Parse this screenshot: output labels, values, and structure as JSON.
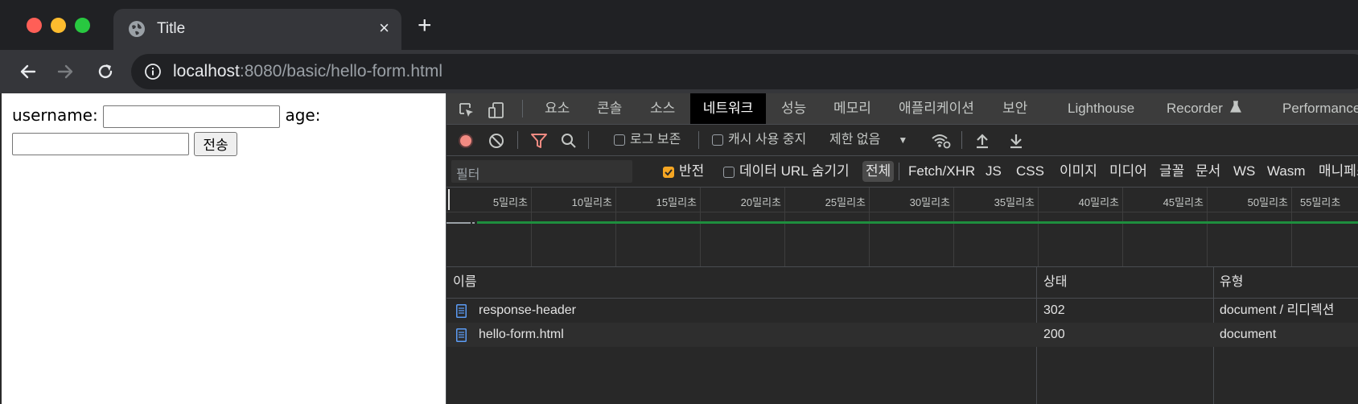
{
  "browser": {
    "tab": {
      "title": "Title",
      "close": "×"
    },
    "new_tab": "+",
    "url": {
      "host": "localhost",
      "rest": ":8080/basic/hello-form.html"
    }
  },
  "page": {
    "username_label": "username:",
    "age_label": "age:",
    "submit_label": "전송",
    "username_value": "",
    "age_value": ""
  },
  "devtools": {
    "tabs": [
      "요소",
      "콘솔",
      "소스",
      "네트워크",
      "성능",
      "메모리",
      "애플리케이션",
      "보안",
      "Lighthouse",
      "Recorder",
      "Performance"
    ],
    "active_tab": "네트워크",
    "network_toolbar": {
      "preserve_log": "로그 보존",
      "disable_cache": "캐시 사용 중지",
      "throttle": "제한 없음"
    },
    "filter": {
      "placeholder": "필터",
      "invert": "반전",
      "hide_data_urls": "데이터 URL 숨기기",
      "types": [
        "전체",
        "Fetch/XHR",
        "JS",
        "CSS",
        "이미지",
        "미디어",
        "글꼴",
        "문서",
        "WS",
        "Wasm",
        "매니페스"
      ]
    },
    "timeline_ticks": [
      "5밀리초",
      "10밀리초",
      "15밀리초",
      "20밀리초",
      "25밀리초",
      "30밀리초",
      "35밀리초",
      "40밀리초",
      "45밀리초",
      "50밀리초",
      "55밀리초"
    ],
    "table": {
      "headers": {
        "name": "이름",
        "status": "상태",
        "type": "유형"
      },
      "rows": [
        {
          "name": "response-header",
          "status": "302",
          "type": "document / 리디렉션"
        },
        {
          "name": "hello-form.html",
          "status": "200",
          "type": "document"
        }
      ]
    }
  },
  "colors": {
    "record": "#f28b82",
    "filter_icon": "#f28b82",
    "waterfall": "#1e8e3e",
    "checkbox_on": "#f5a623"
  }
}
